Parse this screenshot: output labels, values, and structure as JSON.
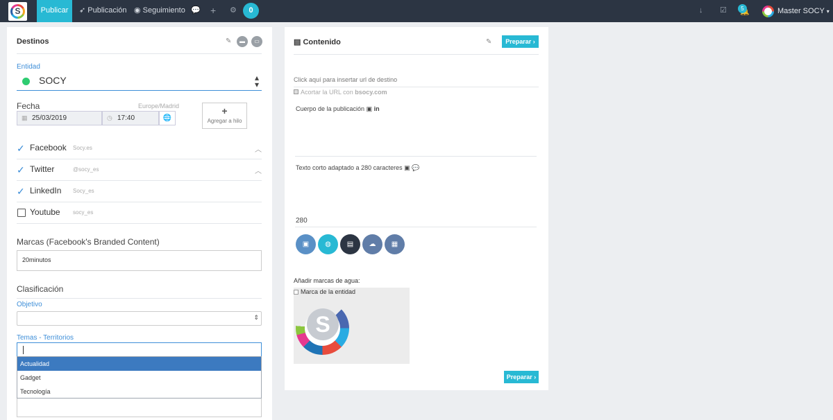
{
  "nav": {
    "publish": "Publicar",
    "publication": "Publicación",
    "tracking": "Seguimiento",
    "counter": "0",
    "notifications_count": "5",
    "user_name": "Master SOCY"
  },
  "left": {
    "title": "Destinos",
    "entity_label": "Entidad",
    "entity_value": "SOCY",
    "date_label": "Fecha",
    "timezone": "Europe/Madrid",
    "date_value": "25/03/2019",
    "time_value": "17:40",
    "hilo_plus": "+",
    "hilo_label": "Agregar a hilo",
    "networks": [
      {
        "name": "Facebook",
        "handle": "Socy.es",
        "checked": true
      },
      {
        "name": "Twitter",
        "handle": "@socy_es",
        "checked": true
      },
      {
        "name": "LinkedIn",
        "handle": "Socy_es",
        "checked": true
      },
      {
        "name": "Youtube",
        "handle": "socy_es",
        "checked": false
      }
    ],
    "brands_label": "Marcas (Facebook's Branded Content)",
    "brands_value": "20minutos",
    "classification_label": "Clasificación",
    "objective_label": "Objetivo",
    "topics_label": "Temas - Territorios",
    "topic_options": [
      "Actualidad",
      "Gadget",
      "Tecnología"
    ]
  },
  "right": {
    "title": "Contenido",
    "prepare_label": "Preparar ›",
    "url_placeholder": "Click aquí para insertar url de destino",
    "shorten_text": "Acortar la URL con",
    "shorten_domain": "bsocy.com",
    "body_label": "Cuerpo de la publicación",
    "short_text_label": "Texto corto adaptado a 280 caracteres",
    "char_count": "280",
    "watermark_title": "Añadir marcas de agua:",
    "watermark_entity": "Marca de la entidad",
    "watermark_letter": "S"
  },
  "colors": {
    "accent": "#28b9d4",
    "topbar": "#2c3543",
    "link_blue": "#3d8ed8",
    "entity_dot": "#2ecc71"
  }
}
